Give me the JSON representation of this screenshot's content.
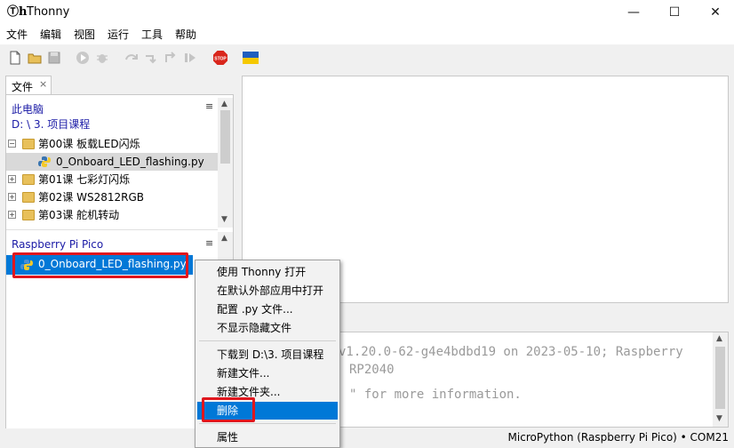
{
  "window": {
    "title": "Thonny",
    "icon": "thonny-app-icon",
    "minimize": "—",
    "maximize": "☐",
    "close": "✕"
  },
  "menu": [
    "文件",
    "编辑",
    "视图",
    "运行",
    "工具",
    "帮助"
  ],
  "toolbar": {
    "icons": [
      "new-file-icon",
      "open-file-icon",
      "save-icon",
      "run-icon",
      "debug-icon",
      "step-over-icon",
      "step-into-icon",
      "step-out-icon",
      "resume-icon",
      "stop-icon",
      "ukraine-flag-icon"
    ],
    "stop_label": "STOP"
  },
  "files_tab": {
    "label": "文件",
    "close": "×"
  },
  "this_computer": {
    "title": "此电脑",
    "path": "D: \\ 3. 项目课程",
    "menu_glyph": "≡",
    "rows": [
      {
        "expander": "⊟",
        "type": "folder",
        "label": "第00课 板载LED闪烁"
      },
      {
        "expander": "",
        "type": "py",
        "label": "0_Onboard_LED_flashing.py",
        "selected": true
      },
      {
        "expander": "⊞",
        "type": "folder",
        "label": "第01课 七彩灯闪烁"
      },
      {
        "expander": "⊞",
        "type": "folder",
        "label": "第02课 WS2812RGB"
      },
      {
        "expander": "⊞",
        "type": "folder",
        "label": "第03课 舵机转动"
      }
    ]
  },
  "pico": {
    "title": "Raspberry Pi Pico",
    "menu_glyph": "≡",
    "file": "0_Onboard_LED_flashing.py"
  },
  "shell": {
    "lines": [
      "v1.20.0-62-g4e4bdbd19 on 2023-05-10; Raspberry",
      "RP2040",
      "\" for more information."
    ]
  },
  "context_menu": {
    "items": [
      {
        "label": "使用 Thonny 打开"
      },
      {
        "label": "在默认外部应用中打开"
      },
      {
        "label": "配置 .py 文件..."
      },
      {
        "label": "不显示隐藏文件"
      },
      {
        "sep": true
      },
      {
        "label": "下载到 D:\\3. 项目课程"
      },
      {
        "label": "新建文件..."
      },
      {
        "label": "新建文件夹..."
      },
      {
        "label": "删除",
        "active": true
      },
      {
        "sep": true
      },
      {
        "label": "属性"
      }
    ]
  },
  "status": "MicroPython (Raspberry Pi Pico)  •  COM21",
  "colors": {
    "accent": "#0078d7",
    "highlight_box": "#e0171e",
    "folder": "#e8c05a",
    "link": "#1a1aa6"
  }
}
